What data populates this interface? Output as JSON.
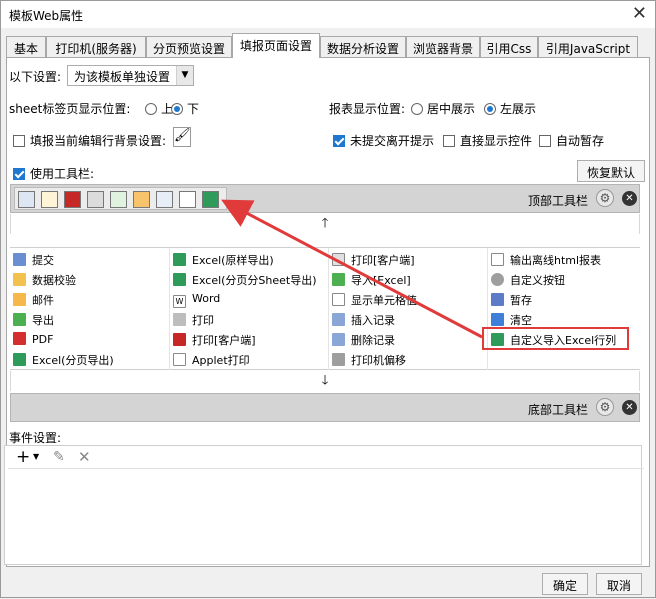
{
  "window": {
    "title": "模板Web属性"
  },
  "tabs": [
    {
      "label": "基本"
    },
    {
      "label": "打印机(服务器)"
    },
    {
      "label": "分页预览设置"
    },
    {
      "label": "填报页面设置"
    },
    {
      "label": "数据分析设置"
    },
    {
      "label": "浏览器背景"
    },
    {
      "label": "引用Css"
    },
    {
      "label": "引用JavaScript"
    }
  ],
  "settings": {
    "label": "以下设置:",
    "value": "为该模板单独设置"
  },
  "sheet_position": {
    "label": "sheet标签页显示位置:",
    "opt_top": "上",
    "opt_bottom": "下",
    "selected": "下"
  },
  "report_position": {
    "label": "报表显示位置:",
    "opt_center": "居中展示",
    "opt_left": "左展示",
    "selected": "左展示"
  },
  "checks": {
    "fill_bg": "填报当前编辑行背景设置:",
    "unsubmitted_leave": "未提交离开提示",
    "direct_show": "直接显示控件",
    "auto_save": "自动暂存",
    "use_toolbar": "使用工具栏:"
  },
  "restore_default": "恢复默认",
  "top_toolbar_label": "顶部工具栏",
  "bottom_toolbar_label": "底部工具栏",
  "buttons_grid": [
    [
      "提交",
      "Excel(原样导出)",
      "打印[客户端]",
      "输出离线html报表"
    ],
    [
      "数据校验",
      "Excel(分页分Sheet导出)",
      "导入[Excel]",
      "自定义按钮"
    ],
    [
      "邮件",
      "Word",
      "显示单元格值",
      "暂存"
    ],
    [
      "导出",
      "打印",
      "插入记录",
      "清空"
    ],
    [
      "PDF",
      "打印[客户端]",
      "删除记录",
      "自定义导入Excel行列"
    ],
    [
      "Excel(分页导出)",
      "Applet打印",
      "打印机偏移",
      ""
    ]
  ],
  "event_settings_label": "事件设置:",
  "ok": "确定",
  "cancel": "取消",
  "colors": {
    "accent": "#1e78d0",
    "highlight": "#e03a3a",
    "arrow": "#e03a3a"
  }
}
